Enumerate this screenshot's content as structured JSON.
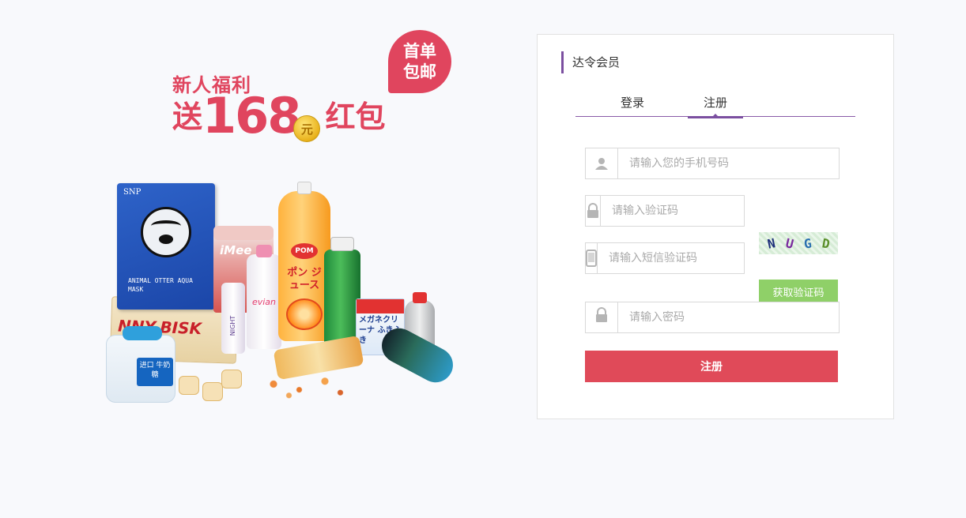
{
  "promo": {
    "line1": "新人福利",
    "send": "送",
    "amount": "168",
    "coin": "元",
    "red_packet": "红包",
    "badge_line1": "首单",
    "badge_line2": "包邮"
  },
  "products": {
    "mask_brand": "SNP",
    "mask_caption": "ANIMAL OTTER AQUA MASK",
    "biscuit_text": "NNY-BISK",
    "tin_label": "iMee",
    "evian_label": "evian",
    "spray_label": "NIGHT",
    "pom_top": "POM",
    "pom_main": "ポン ジュース",
    "megane_text": "メガネクリーナ ふきふき",
    "jar_label": "进口 牛奶糖"
  },
  "panel": {
    "title": "达令会员",
    "tabs": [
      {
        "label": "登录",
        "active": false
      },
      {
        "label": "注册",
        "active": true
      }
    ],
    "phone_placeholder": "请输入您的手机号码",
    "captcha_placeholder": "请输入验证码",
    "sms_placeholder": "请输入短信验证码",
    "password_placeholder": "请输入密码",
    "captcha_chars": [
      "N",
      "U",
      "G",
      "D"
    ],
    "sms_button": "获取验证码",
    "submit_button": "注册"
  },
  "colors": {
    "accent_purple": "#7b4fa0",
    "promo_red": "#e0455e",
    "submit_red": "#e04a59",
    "sms_green": "#8fd068"
  }
}
